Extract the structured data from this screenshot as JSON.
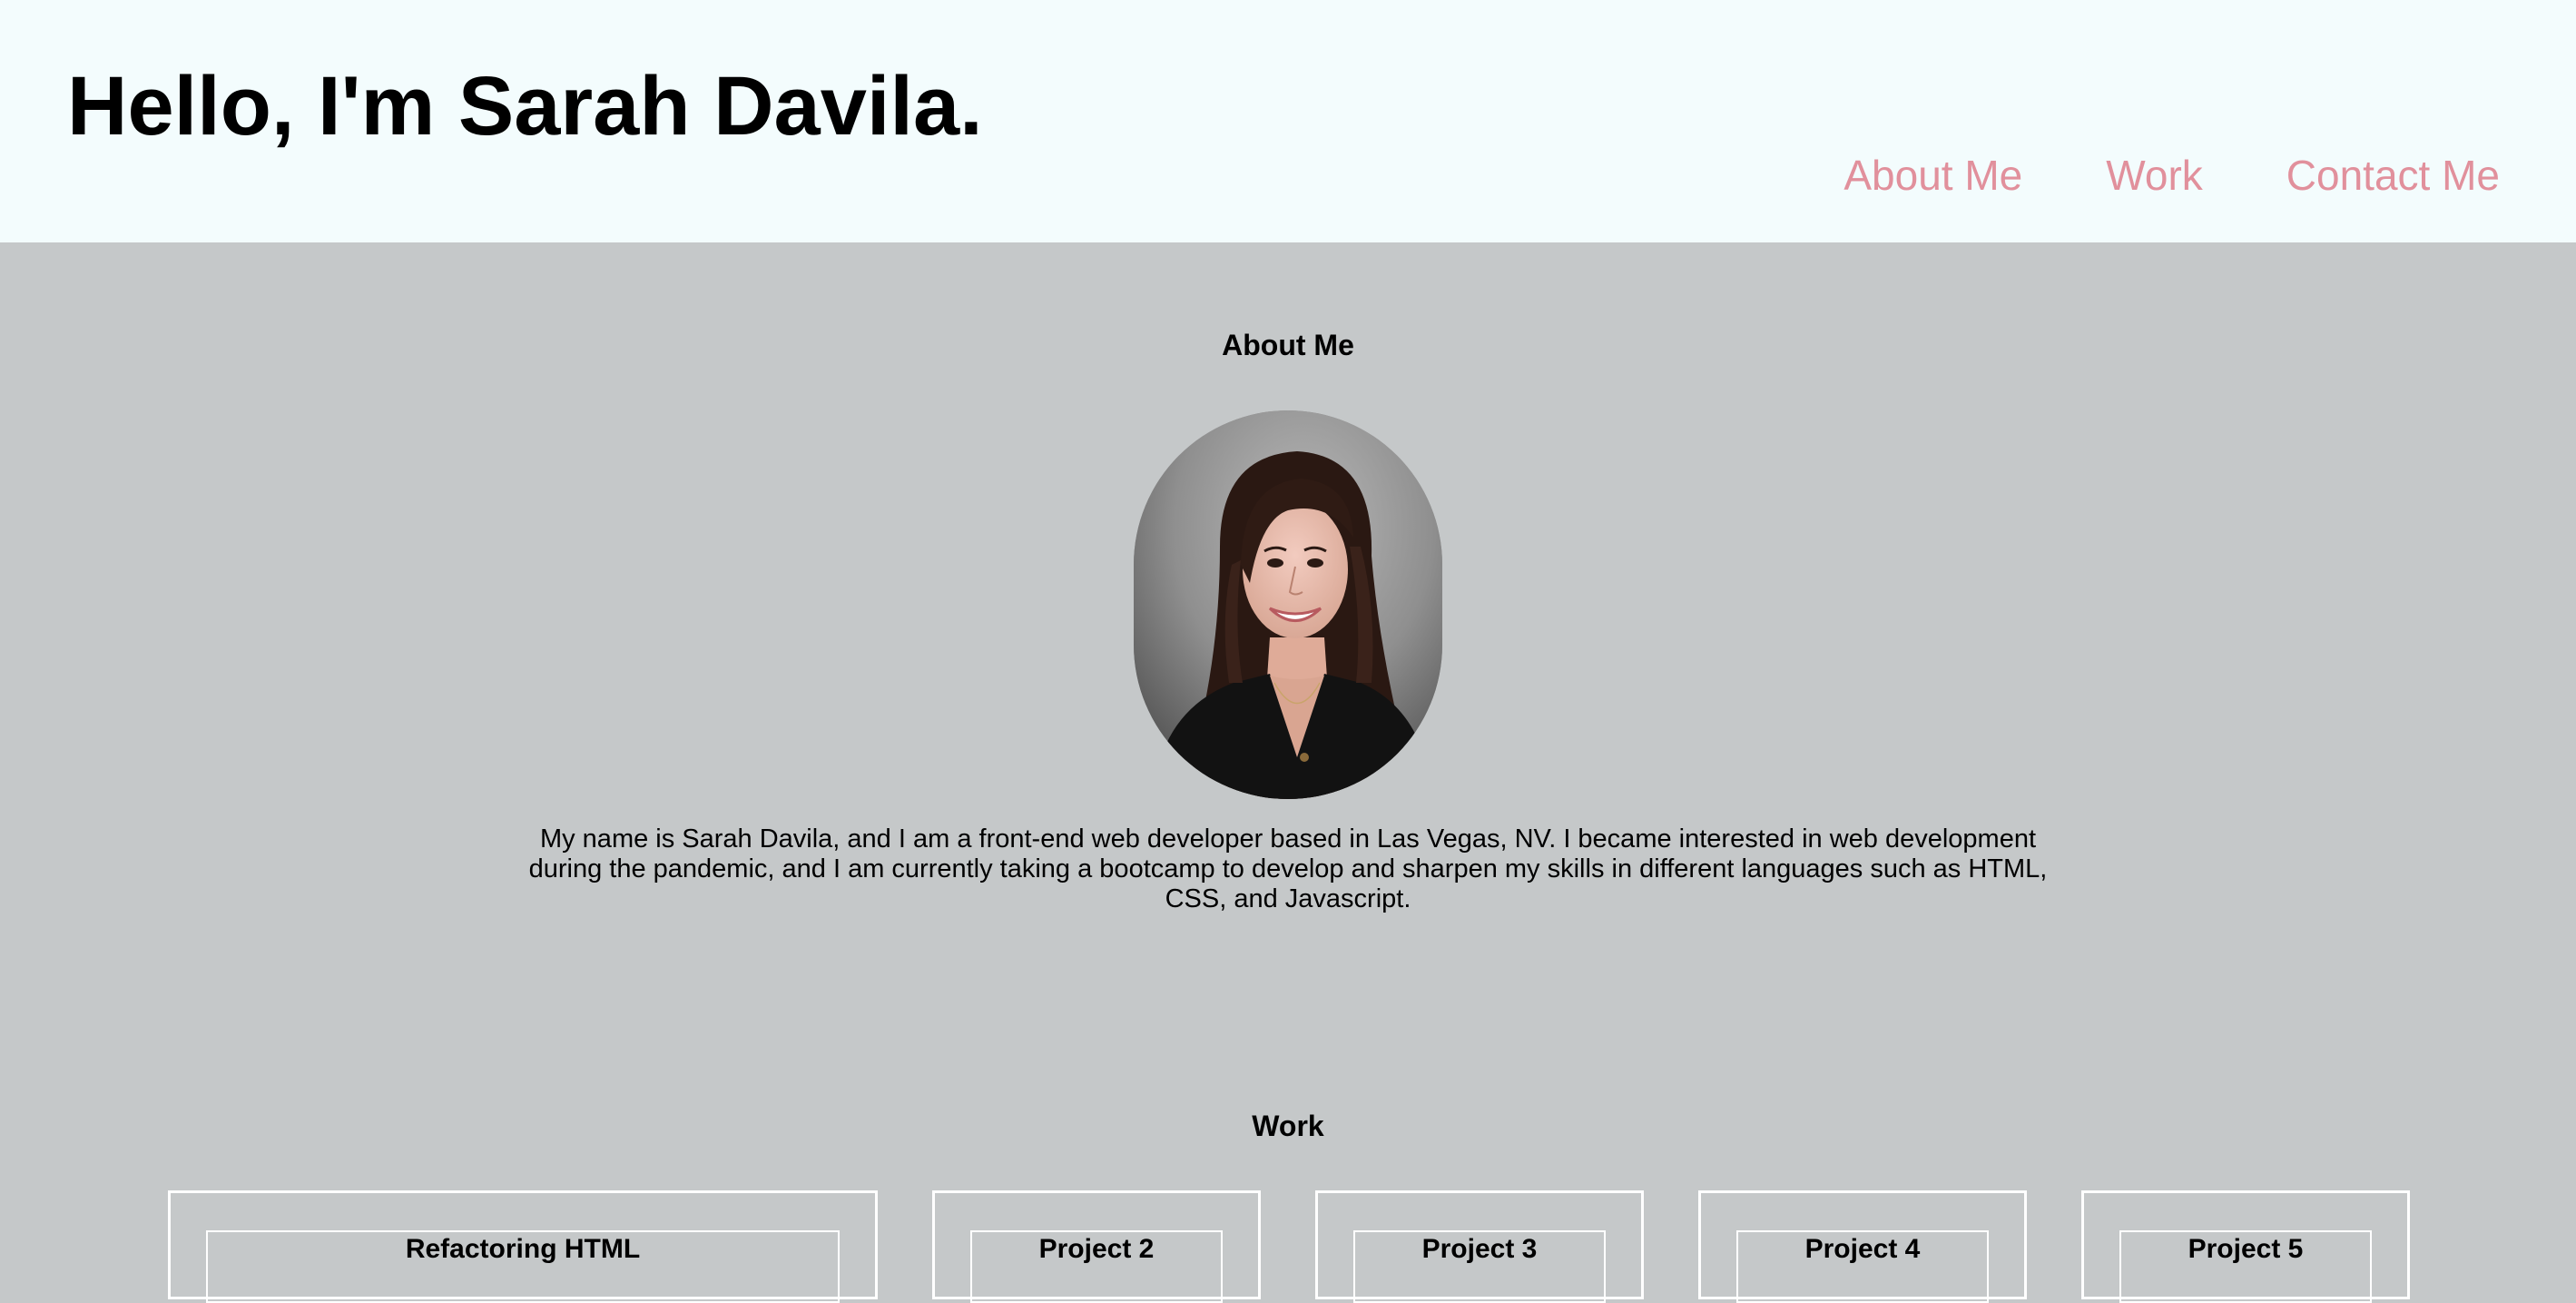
{
  "header": {
    "title": "Hello, I'm Sarah Davila.",
    "nav": [
      "About Me",
      "Work",
      "Contact Me"
    ],
    "nav_color": "#e1909c",
    "background": "#f3fcfd"
  },
  "about": {
    "heading": "About Me",
    "photo_alt": "Portrait of Sarah Davila",
    "bio": "My name is Sarah Davila, and I am a front-end web developer based in Las Vegas, NV. I became interested in web development during the pandemic, and I am currently taking a bootcamp to develop and sharpen my skills in different languages such as HTML, CSS, and Javascript."
  },
  "work": {
    "heading": "Work",
    "projects": [
      {
        "title": "Refactoring HTML"
      },
      {
        "title": "Project 2"
      },
      {
        "title": "Project 3"
      },
      {
        "title": "Project 4"
      },
      {
        "title": "Project 5"
      }
    ]
  },
  "colors": {
    "page_background": "#c5c8c9",
    "card_border": "#ffffff"
  }
}
